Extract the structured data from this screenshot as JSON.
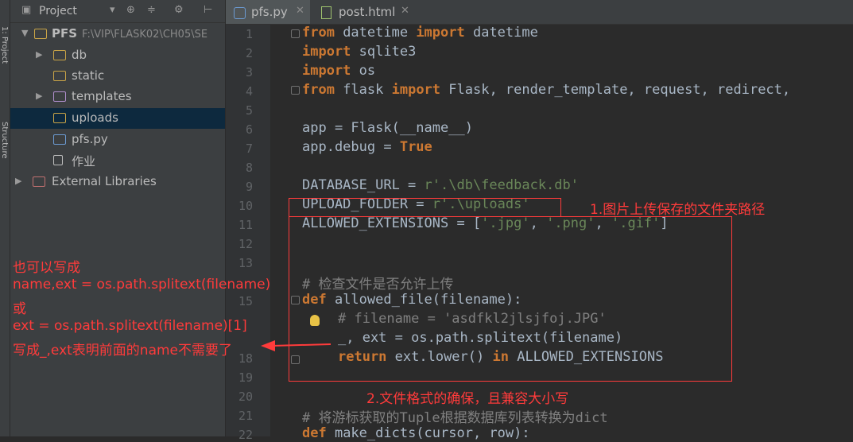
{
  "left_strip": {
    "label_top": "1: Project",
    "label_mid": "Structure"
  },
  "project_panel": {
    "title": "Project",
    "tree": [
      {
        "label": "PFS",
        "path": "F:\\VIP\\FLASK02\\CH05\\SE",
        "type": "root"
      },
      {
        "label": "db",
        "type": "folder"
      },
      {
        "label": "static",
        "type": "folder"
      },
      {
        "label": "templates",
        "type": "folder"
      },
      {
        "label": "uploads",
        "type": "folder",
        "selected": true
      },
      {
        "label": "pfs.py",
        "type": "file"
      },
      {
        "label": "作业",
        "type": "file"
      },
      {
        "label": "External Libraries",
        "type": "library"
      }
    ]
  },
  "tabs": [
    {
      "label": "pfs.py",
      "active": true
    },
    {
      "label": "post.html",
      "active": false
    }
  ],
  "line_numbers": [
    "1",
    "2",
    "3",
    "4",
    "5",
    "6",
    "7",
    "8",
    "9",
    "10",
    "11",
    "12",
    "13",
    "",
    "15",
    "",
    "",
    "18",
    "19",
    "20",
    "21",
    "22"
  ],
  "code": {
    "l1": [
      "from",
      " datetime ",
      "import",
      " datetime"
    ],
    "l2": [
      "import",
      " sqlite3"
    ],
    "l3": [
      "import",
      " os"
    ],
    "l4": [
      "from",
      " flask ",
      "import",
      " Flask, render_template, request, redirect,"
    ],
    "l6": "app = Flask(__name__)",
    "l7": [
      "app.debug = ",
      "True"
    ],
    "l9": [
      "DATABASE_URL = ",
      "r'.\\db\\feedback.db'"
    ],
    "l10": [
      "UPLOAD_FOLDER = ",
      "r'.\\uploads'"
    ],
    "l11": [
      "ALLOWED_EXTENSIONS = [",
      "'.jpg'",
      ", ",
      "'.png'",
      ", ",
      "'.gif'",
      "]"
    ],
    "l14": "# 检查文件是否允许上传",
    "l15": [
      "def",
      " allowed_file(filename):"
    ],
    "l16": "# filename = 'asdfkl2jlsjfoj.JPG'",
    "l17": "_, ext = os.path.splitext(filename)",
    "l18": [
      "return",
      " ext.lower() ",
      "in",
      " ALLOWED_EXTENSIONS"
    ],
    "l21": "# 将游标获取的Tuple根据数据库列表转换为dict",
    "l22": [
      "def",
      " make_dicts(cursor, row):"
    ]
  },
  "annotations": {
    "upload_note": "1.图片上传保存的文件夹路径",
    "format_note": "2.文件格式的确保，且兼容大小写",
    "left_notes": [
      "也可以写成",
      "name,ext = os.path.splitext(filename)",
      "或",
      "ext = os.path.splitext(filename)[1]",
      "写成_,ext表明前面的name不需要了"
    ]
  },
  "colors": {
    "annotation": "#ff3b3b",
    "keyword": "#cc7832",
    "string": "#6a8759",
    "comment": "#808080"
  }
}
